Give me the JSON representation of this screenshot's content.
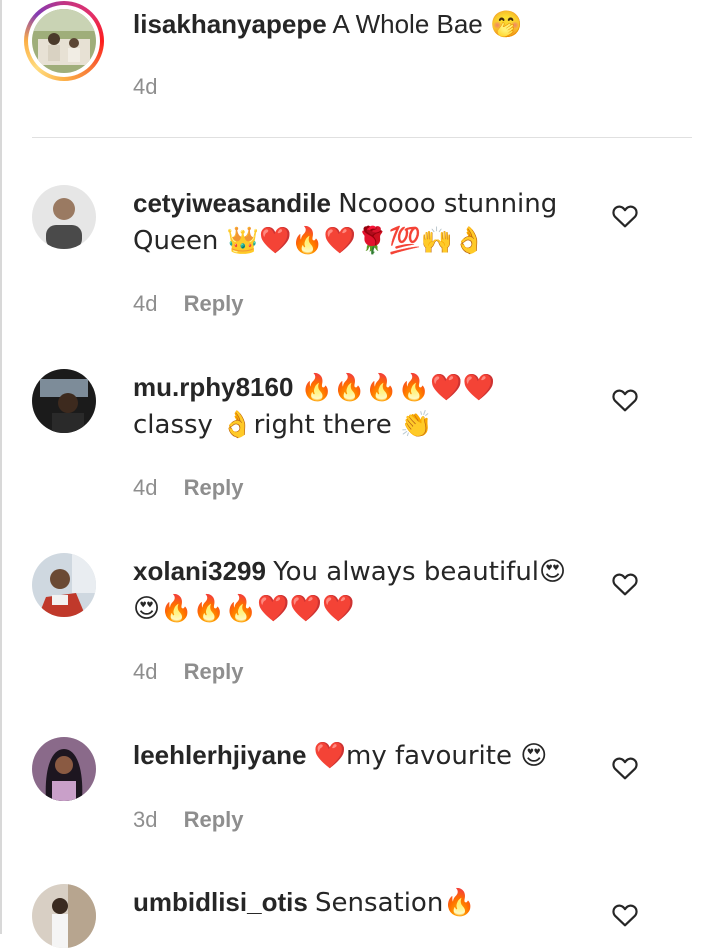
{
  "caption": {
    "username": "lisakhanyapepe",
    "text": "A Whole Bae 🤭",
    "time": "4d"
  },
  "comments": [
    {
      "username": "cetyiweasandile",
      "text": "Ncoooo stunning Queen 👑❤️🔥❤️🌹💯🙌👌",
      "time": "4d",
      "reply_label": "Reply"
    },
    {
      "username": "mu.rphy8160",
      "text": "🔥🔥🔥🔥❤️❤️ classy 👌right there 👏",
      "time": "4d",
      "reply_label": "Reply"
    },
    {
      "username": "xolani3299",
      "text": "You always beautiful😍😍🔥🔥🔥❤️❤️❤️",
      "time": "4d",
      "reply_label": "Reply"
    },
    {
      "username": "leehlerhjiyane",
      "text": "❤️my favourite 😍",
      "time": "3d",
      "reply_label": "Reply"
    },
    {
      "username": "umbidlisi_otis",
      "text": "Sensation🔥",
      "time": "",
      "reply_label": ""
    }
  ],
  "icons": {
    "like": "heart-outline-icon"
  },
  "colors": {
    "text": "#262626",
    "secondary": "#8e8e8e",
    "divider": "#e0e0e0"
  }
}
